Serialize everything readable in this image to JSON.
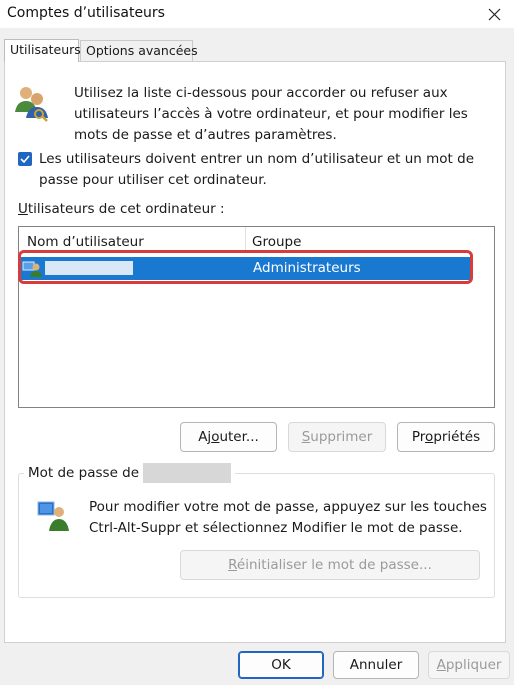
{
  "window": {
    "title": "Comptes d’utilisateurs"
  },
  "tabs": [
    {
      "label": "Utilisateurs"
    },
    {
      "label": "Options avancées"
    }
  ],
  "intro": {
    "text": "Utilisez la liste ci-dessous pour accorder ou refuser aux utilisateurs l’accès à votre ordinateur, et pour modifier les mots de passe et d’autres paramètres."
  },
  "require_login": {
    "checked": true,
    "label": "Les utilisateurs doivent entrer un nom d’utilisateur et un mot de passe pour utiliser cet ordinateur."
  },
  "users_section": {
    "label_prefix": "",
    "label_accel": "U",
    "label_rest": "tilisateurs de cet ordinateur :",
    "columns": [
      "Nom d’utilisateur",
      "Groupe"
    ],
    "rows": [
      {
        "group": "Administrateurs"
      }
    ]
  },
  "buttons": {
    "add_pre": "Aj",
    "add_accel": "o",
    "add_post": "uter...",
    "remove_pre": "",
    "remove_accel": "S",
    "remove_post": "upprimer",
    "props_pre": "Pr",
    "props_accel": "o",
    "props_post": "priétés"
  },
  "password_group": {
    "label": "Mot de passe de",
    "text": "Pour modifier votre mot de passe, appuyez sur les touches Ctrl-Alt-Suppr et sélectionnez Modifier le mot de passe.",
    "reset_pre": "",
    "reset_accel": "R",
    "reset_post": "éinitialiser le mot de passe..."
  },
  "footer": {
    "ok": "OK",
    "cancel": "Annuler",
    "apply_pre": "",
    "apply_accel": "A",
    "apply_post": "ppliquer"
  },
  "colors": {
    "accent": "#1f66c1",
    "selection": "#1979d1",
    "highlight": "#d93a3a"
  }
}
